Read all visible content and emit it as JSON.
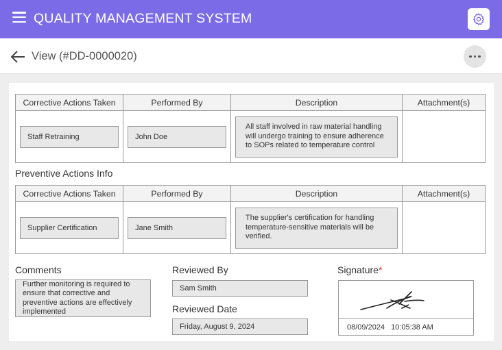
{
  "header": {
    "app_title": "QUALITY MANAGEMENT SYSTEM",
    "menu_icon": "hamburger-menu-icon",
    "settings_icon": "gear-icon",
    "brand_color": "#7b6be6"
  },
  "subheader": {
    "back_icon": "arrow-left-icon",
    "view_title": "View (#DD-0000020)",
    "more_icon": "more-horizontal-icon"
  },
  "corrective_table": {
    "headers": [
      "Corrective Actions Taken",
      "Performed By",
      "Description",
      "Attachment(s)"
    ],
    "rows": [
      {
        "action": "Staff Retraining",
        "performed_by": "John Doe",
        "description": "All staff involved in raw material handling will undergo training to ensure adherence to SOPs related to temperature control",
        "attachments": ""
      }
    ]
  },
  "preventive_section": {
    "title": "Preventive Actions Info",
    "headers": [
      "Corrective Actions Taken",
      "Performed By",
      "Description",
      "Attachment(s)"
    ],
    "rows": [
      {
        "action": "Supplier Certification",
        "performed_by": "Jane Smith",
        "description": "The supplier's certification for handling temperature-sensitive materials will be verified.",
        "attachments": ""
      }
    ]
  },
  "comments": {
    "label": "Comments",
    "value": "Further monitoring is required to ensure that corrective and preventive actions are effectively implemented"
  },
  "review": {
    "reviewed_by_label": "Reviewed By",
    "reviewed_by_value": "Sam Smith",
    "reviewed_date_label": "Reviewed Date",
    "reviewed_date_value": "Friday, August 9, 2024"
  },
  "signature": {
    "label": "Signature",
    "required_mark": "*",
    "date": "08/09/2024",
    "time": "10:05:38 AM"
  }
}
